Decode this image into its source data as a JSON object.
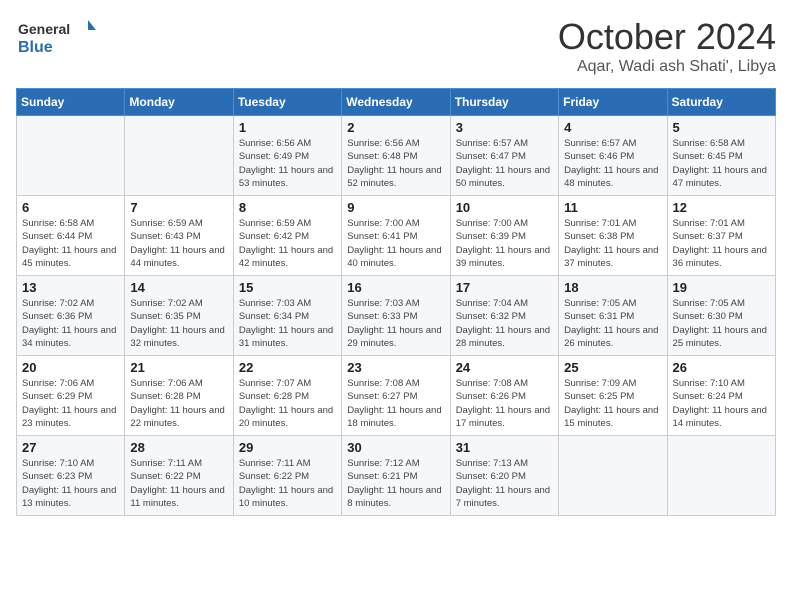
{
  "header": {
    "logo_general": "General",
    "logo_blue": "Blue",
    "month_title": "October 2024",
    "location": "Aqar, Wadi ash Shati', Libya"
  },
  "weekdays": [
    "Sunday",
    "Monday",
    "Tuesday",
    "Wednesday",
    "Thursday",
    "Friday",
    "Saturday"
  ],
  "weeks": [
    [
      null,
      null,
      {
        "day": 1,
        "sunrise": "6:56 AM",
        "sunset": "6:49 PM",
        "daylight": "11 hours and 53 minutes."
      },
      {
        "day": 2,
        "sunrise": "6:56 AM",
        "sunset": "6:48 PM",
        "daylight": "11 hours and 52 minutes."
      },
      {
        "day": 3,
        "sunrise": "6:57 AM",
        "sunset": "6:47 PM",
        "daylight": "11 hours and 50 minutes."
      },
      {
        "day": 4,
        "sunrise": "6:57 AM",
        "sunset": "6:46 PM",
        "daylight": "11 hours and 48 minutes."
      },
      {
        "day": 5,
        "sunrise": "6:58 AM",
        "sunset": "6:45 PM",
        "daylight": "11 hours and 47 minutes."
      }
    ],
    [
      {
        "day": 6,
        "sunrise": "6:58 AM",
        "sunset": "6:44 PM",
        "daylight": "11 hours and 45 minutes."
      },
      {
        "day": 7,
        "sunrise": "6:59 AM",
        "sunset": "6:43 PM",
        "daylight": "11 hours and 44 minutes."
      },
      {
        "day": 8,
        "sunrise": "6:59 AM",
        "sunset": "6:42 PM",
        "daylight": "11 hours and 42 minutes."
      },
      {
        "day": 9,
        "sunrise": "7:00 AM",
        "sunset": "6:41 PM",
        "daylight": "11 hours and 40 minutes."
      },
      {
        "day": 10,
        "sunrise": "7:00 AM",
        "sunset": "6:39 PM",
        "daylight": "11 hours and 39 minutes."
      },
      {
        "day": 11,
        "sunrise": "7:01 AM",
        "sunset": "6:38 PM",
        "daylight": "11 hours and 37 minutes."
      },
      {
        "day": 12,
        "sunrise": "7:01 AM",
        "sunset": "6:37 PM",
        "daylight": "11 hours and 36 minutes."
      }
    ],
    [
      {
        "day": 13,
        "sunrise": "7:02 AM",
        "sunset": "6:36 PM",
        "daylight": "11 hours and 34 minutes."
      },
      {
        "day": 14,
        "sunrise": "7:02 AM",
        "sunset": "6:35 PM",
        "daylight": "11 hours and 32 minutes."
      },
      {
        "day": 15,
        "sunrise": "7:03 AM",
        "sunset": "6:34 PM",
        "daylight": "11 hours and 31 minutes."
      },
      {
        "day": 16,
        "sunrise": "7:03 AM",
        "sunset": "6:33 PM",
        "daylight": "11 hours and 29 minutes."
      },
      {
        "day": 17,
        "sunrise": "7:04 AM",
        "sunset": "6:32 PM",
        "daylight": "11 hours and 28 minutes."
      },
      {
        "day": 18,
        "sunrise": "7:05 AM",
        "sunset": "6:31 PM",
        "daylight": "11 hours and 26 minutes."
      },
      {
        "day": 19,
        "sunrise": "7:05 AM",
        "sunset": "6:30 PM",
        "daylight": "11 hours and 25 minutes."
      }
    ],
    [
      {
        "day": 20,
        "sunrise": "7:06 AM",
        "sunset": "6:29 PM",
        "daylight": "11 hours and 23 minutes."
      },
      {
        "day": 21,
        "sunrise": "7:06 AM",
        "sunset": "6:28 PM",
        "daylight": "11 hours and 22 minutes."
      },
      {
        "day": 22,
        "sunrise": "7:07 AM",
        "sunset": "6:28 PM",
        "daylight": "11 hours and 20 minutes."
      },
      {
        "day": 23,
        "sunrise": "7:08 AM",
        "sunset": "6:27 PM",
        "daylight": "11 hours and 18 minutes."
      },
      {
        "day": 24,
        "sunrise": "7:08 AM",
        "sunset": "6:26 PM",
        "daylight": "11 hours and 17 minutes."
      },
      {
        "day": 25,
        "sunrise": "7:09 AM",
        "sunset": "6:25 PM",
        "daylight": "11 hours and 15 minutes."
      },
      {
        "day": 26,
        "sunrise": "7:10 AM",
        "sunset": "6:24 PM",
        "daylight": "11 hours and 14 minutes."
      }
    ],
    [
      {
        "day": 27,
        "sunrise": "7:10 AM",
        "sunset": "6:23 PM",
        "daylight": "11 hours and 13 minutes."
      },
      {
        "day": 28,
        "sunrise": "7:11 AM",
        "sunset": "6:22 PM",
        "daylight": "11 hours and 11 minutes."
      },
      {
        "day": 29,
        "sunrise": "7:11 AM",
        "sunset": "6:22 PM",
        "daylight": "11 hours and 10 minutes."
      },
      {
        "day": 30,
        "sunrise": "7:12 AM",
        "sunset": "6:21 PM",
        "daylight": "11 hours and 8 minutes."
      },
      {
        "day": 31,
        "sunrise": "7:13 AM",
        "sunset": "6:20 PM",
        "daylight": "11 hours and 7 minutes."
      },
      null,
      null
    ]
  ]
}
